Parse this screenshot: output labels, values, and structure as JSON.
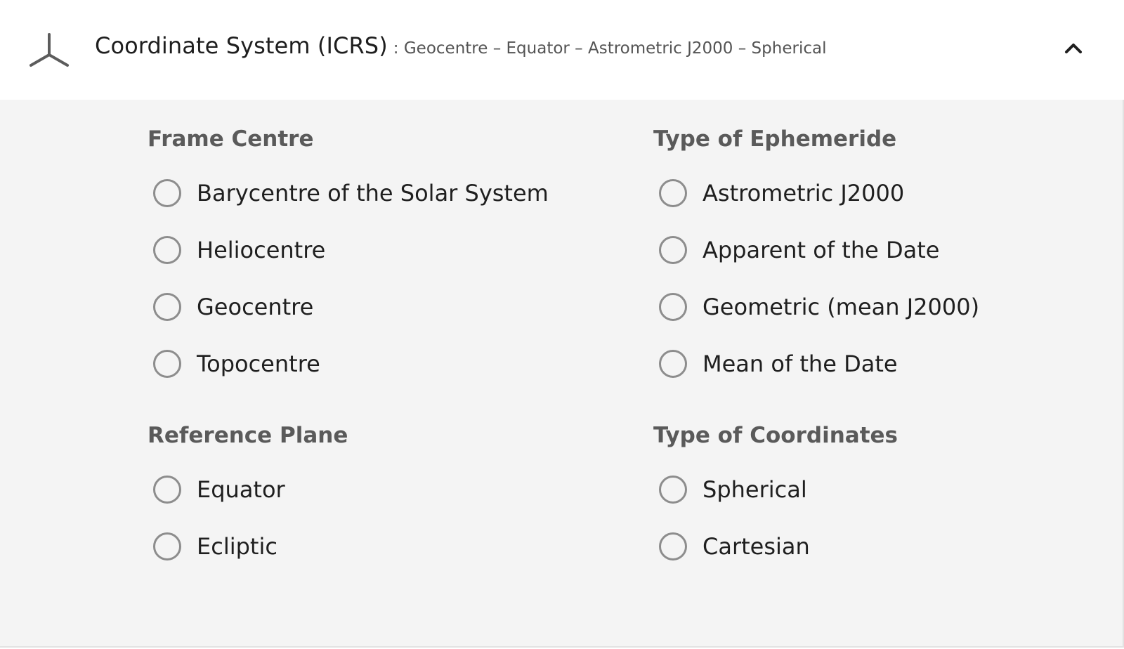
{
  "header": {
    "icon": "axes-icon",
    "title": "Coordinate System (ICRS)",
    "summary": ": Geocentre – Equator – Astrometric J2000 – Spherical",
    "collapse_icon": "chevron-up-icon"
  },
  "groups": {
    "frame_centre": {
      "title": "Frame Centre",
      "options": [
        "Barycentre of the Solar System",
        "Heliocentre",
        "Geocentre",
        "Topocentre"
      ]
    },
    "reference_plane": {
      "title": "Reference Plane",
      "options": [
        "Equator",
        "Ecliptic"
      ]
    },
    "ephemeride_type": {
      "title": "Type of Ephemeride",
      "options": [
        "Astrometric J2000",
        "Apparent of the Date",
        "Geometric (mean J2000)",
        "Mean of the Date"
      ]
    },
    "coordinates_type": {
      "title": "Type of Coordinates",
      "options": [
        "Spherical",
        "Cartesian"
      ]
    }
  },
  "colors": {
    "header_bg": "#ffffff",
    "body_bg": "#f4f4f4",
    "group_title": "#5a5a5a",
    "radio_border": "#8d8d8d"
  }
}
